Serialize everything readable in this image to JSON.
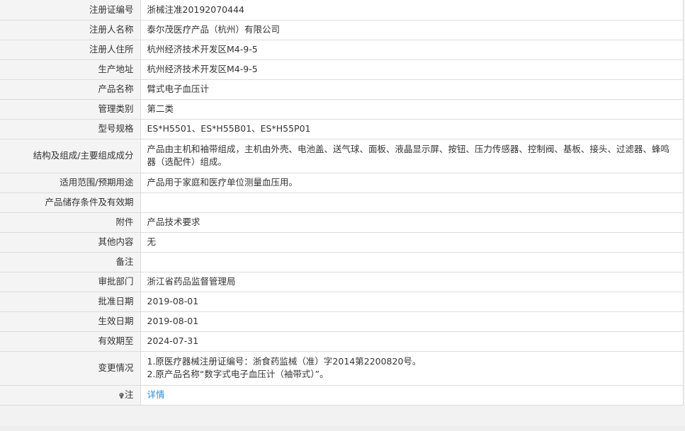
{
  "rows": [
    {
      "label": "注册证编号",
      "value": "浙械注准20192070444"
    },
    {
      "label": "注册人名称",
      "value": "泰尔茂医疗产品（杭州）有限公司"
    },
    {
      "label": "注册人住所",
      "value": "杭州经济技术开发区M4-9-5"
    },
    {
      "label": "生产地址",
      "value": "杭州经济技术开发区M4-9-5"
    },
    {
      "label": "产品名称",
      "value": "臂式电子血压计"
    },
    {
      "label": "管理类别",
      "value": "第二类"
    },
    {
      "label": "型号规格",
      "value": "ES*H5501、ES*H55B01、ES*H55P01"
    },
    {
      "label": "结构及组成/主要组成成分",
      "value": "产品由主机和袖带组成，主机由外壳、电池盖、送气球、面板、液晶显示屏、按钮、压力传感器、控制阀、基板、接头、过滤器、蜂鸣器（选配件）组成。"
    },
    {
      "label": "适用范围/预期用途",
      "value": "产品用于家庭和医疗单位测量血压用。"
    },
    {
      "label": "产品储存条件及有效期",
      "value": ""
    },
    {
      "label": "附件",
      "value": "产品技术要求"
    },
    {
      "label": "其他内容",
      "value": "无"
    },
    {
      "label": "备注",
      "value": ""
    },
    {
      "label": "审批部门",
      "value": "浙江省药品监督管理局"
    },
    {
      "label": "批准日期",
      "value": "2019-08-01"
    },
    {
      "label": "生效日期",
      "value": "2019-08-01"
    },
    {
      "label": "有效期至",
      "value": "2024-07-31"
    }
  ],
  "changes": {
    "label": "变更情况",
    "line1": "1.原医疗器械注册证编号：浙食药监械（准）字2014第2200820号。",
    "line2": "2.原产品名称“数字式电子血压计（袖带式）”。"
  },
  "note": {
    "label": "注",
    "icon": "bulb-icon",
    "link_text": "详情",
    "link_color": "#2a8cd6"
  }
}
